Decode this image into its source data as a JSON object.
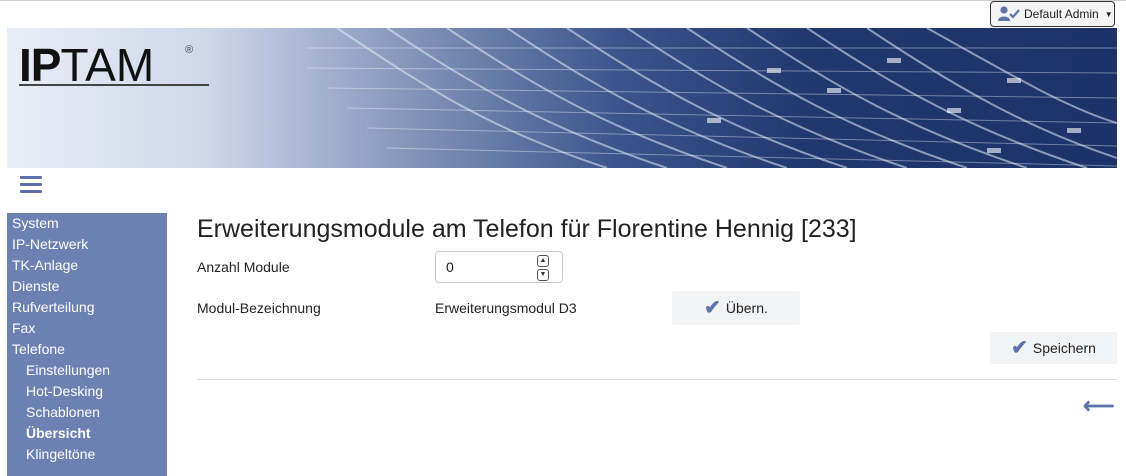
{
  "header": {
    "user_label": "Default Admin",
    "logo_text_bold": "IP",
    "logo_text_rest": "TAM",
    "logo_mark": "®"
  },
  "sidebar": {
    "items": [
      {
        "label": "System",
        "level": 0
      },
      {
        "label": "IP-Netzwerk",
        "level": 0
      },
      {
        "label": "TK-Anlage",
        "level": 0
      },
      {
        "label": "Dienste",
        "level": 0
      },
      {
        "label": "Rufverteilung",
        "level": 0
      },
      {
        "label": "Fax",
        "level": 0
      },
      {
        "label": "Telefone",
        "level": 0
      },
      {
        "label": "Einstellungen",
        "level": 1
      },
      {
        "label": "Hot-Desking",
        "level": 1
      },
      {
        "label": "Schablonen",
        "level": 1
      },
      {
        "label": "Übersicht",
        "level": 1,
        "active": true
      },
      {
        "label": "Klingeltöne",
        "level": 1
      }
    ]
  },
  "main": {
    "title": "Erweiterungsmodule am Telefon für Florentine Hennig [233]",
    "count_label": "Anzahl Module",
    "count_value": "0",
    "module_label": "Modul-Bezeichnung",
    "module_value": "Erweiterungsmodul D3",
    "apply_button": "Übern.",
    "save_button": "Speichern"
  },
  "colors": {
    "accent": "#5e73a9",
    "sidebar_bg": "#6c80b2"
  }
}
